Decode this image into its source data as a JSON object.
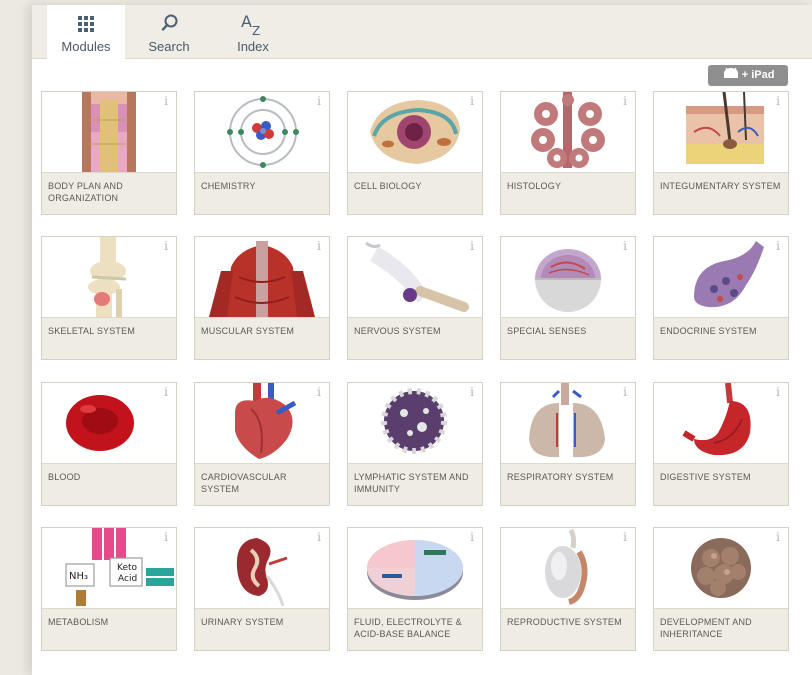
{
  "tabs": [
    {
      "label": "Modules",
      "icon": "grid-icon",
      "active": true
    },
    {
      "label": "Search",
      "icon": "search-icon",
      "active": false
    },
    {
      "label": "Index",
      "icon": "a-z-icon",
      "active": false
    }
  ],
  "index_icon_text": {
    "a": "A",
    "z": "Z"
  },
  "platform_badge": " + iPad",
  "info_glyph": "i",
  "modules": [
    {
      "label": "BODY PLAN AND ORGANIZATION",
      "icon": "body-plan-icon"
    },
    {
      "label": "CHEMISTRY",
      "icon": "atom-icon"
    },
    {
      "label": "CELL BIOLOGY",
      "icon": "cell-icon"
    },
    {
      "label": "HISTOLOGY",
      "icon": "gland-tissue-icon"
    },
    {
      "label": "INTEGUMENTARY SYSTEM",
      "icon": "skin-cross-section-icon"
    },
    {
      "label": "SKELETAL SYSTEM",
      "icon": "knee-joint-icon"
    },
    {
      "label": "MUSCULAR SYSTEM",
      "icon": "back-muscles-icon"
    },
    {
      "label": "NERVOUS SYSTEM",
      "icon": "neuron-icon"
    },
    {
      "label": "SPECIAL SENSES",
      "icon": "eyeball-icon"
    },
    {
      "label": "ENDOCRINE SYSTEM",
      "icon": "gland-icon"
    },
    {
      "label": "BLOOD",
      "icon": "red-blood-cell-icon"
    },
    {
      "label": "CARDIOVASCULAR SYSTEM",
      "icon": "heart-icon"
    },
    {
      "label": "LYMPHATIC SYSTEM AND IMMUNITY",
      "icon": "lymph-cell-icon"
    },
    {
      "label": "RESPIRATORY SYSTEM",
      "icon": "lungs-icon"
    },
    {
      "label": "DIGESTIVE SYSTEM",
      "icon": "stomach-icon"
    },
    {
      "label": "METABOLISM",
      "icon": "metabolism-diagram-icon"
    },
    {
      "label": "URINARY SYSTEM",
      "icon": "kidney-icon"
    },
    {
      "label": "FLUID, ELECTROLYTE & ACID-BASE BALANCE",
      "icon": "fluid-balance-icon"
    },
    {
      "label": "REPRODUCTIVE SYSTEM",
      "icon": "testis-icon"
    },
    {
      "label": "DEVELOPMENT AND INHERITANCE",
      "icon": "embryo-icon"
    }
  ],
  "metabolism_labels": {
    "left": "NH₃",
    "right_line1": "Keto",
    "right_line2": "Acid"
  }
}
